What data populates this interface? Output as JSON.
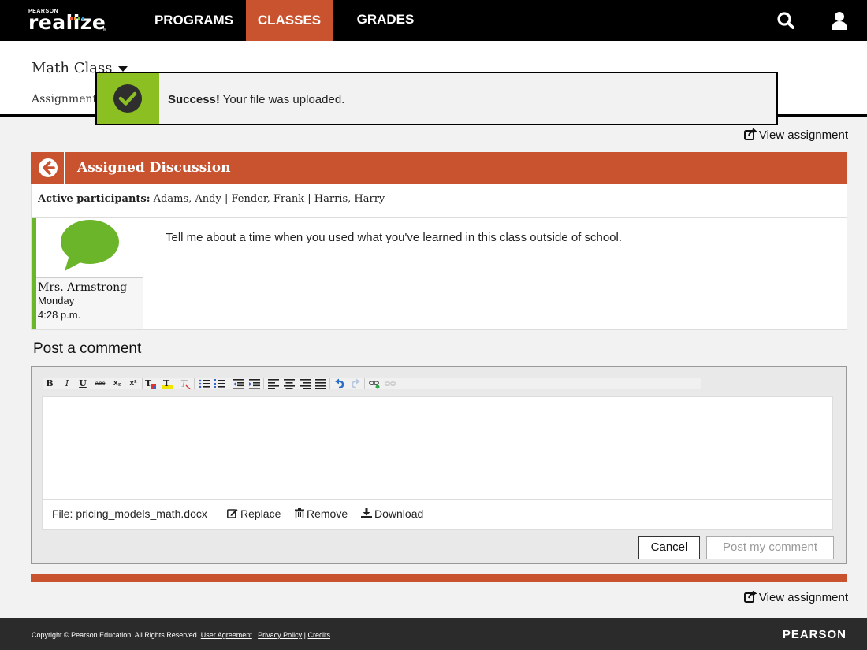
{
  "logo": {
    "top_text": "PEARSON",
    "name": "realize",
    "tm": "TM"
  },
  "nav": {
    "programs": "PROGRAMS",
    "classes": "CLASSES",
    "grades": "GRADES"
  },
  "colors": {
    "accent": "#c9532f",
    "success": "#8cbf22",
    "participant_bar": "#6bb52a",
    "nav_bg": "#000000",
    "footer_bg": "#2b2b2b"
  },
  "icons": {
    "search": "search-icon",
    "user": "user-icon",
    "check": "check-circle-icon",
    "back": "arrow-left-circle-icon",
    "chat": "speech-bubble-icon",
    "external": "external-link-icon"
  },
  "class_header": {
    "title": "Math Class",
    "subnav": "Assignments"
  },
  "toast": {
    "strong": "Success!",
    "message": " Your file was uploaded."
  },
  "view_assignment": "View assignment",
  "discussion": {
    "title": "Assigned Discussion",
    "participants_label": "Active participants:",
    "participants": " Adams, Andy | Fender, Frank | Harris, Harry",
    "post": {
      "author": "Mrs. Armstrong",
      "day": "Monday",
      "time": "4:28 p.m.",
      "text": "Tell me about a time when you used what you've learned in this class outside of school."
    }
  },
  "comment": {
    "heading": "Post a comment",
    "file_label": "File: pricing_models_math.docx",
    "replace": "Replace",
    "remove": "Remove",
    "download": "Download",
    "cancel": "Cancel",
    "post": "Post my comment"
  },
  "toolbar": {
    "bold": "B",
    "italic": "I",
    "underline": "U",
    "strike": "abc",
    "subscript": "x₂",
    "superscript": "x²"
  },
  "footer": {
    "copyright": "Copyright © Pearson Education, All Rights Reserved.",
    "user_agreement": "User Agreement",
    "privacy": "Privacy Policy",
    "credits": "Credits",
    "brand": "PEARSON"
  }
}
